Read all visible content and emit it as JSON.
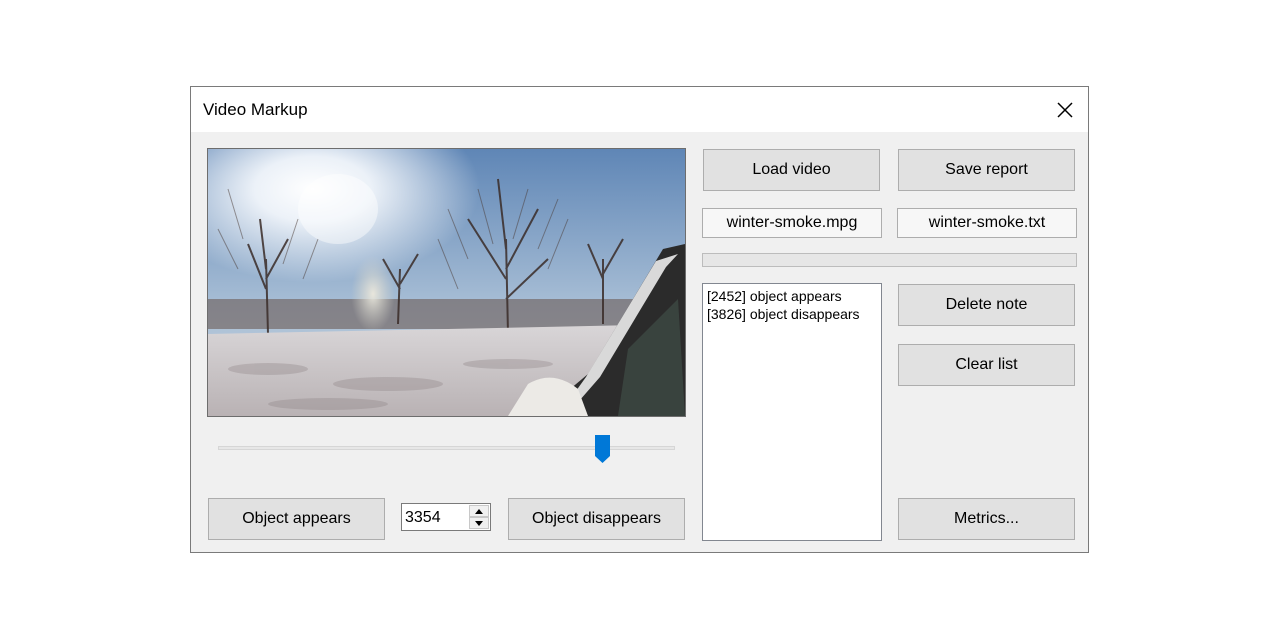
{
  "window": {
    "title": "Video Markup",
    "close_icon": "close-icon"
  },
  "video": {
    "frame_description_icon": "video-preview"
  },
  "slider": {
    "position": 0.84
  },
  "controls": {
    "appears_label": "Object appears",
    "frame_value": "3354",
    "disappears_label": "Object disappears"
  },
  "right": {
    "load_video_label": "Load video",
    "save_report_label": "Save report",
    "video_file": "winter-smoke.mpg",
    "report_file": "winter-smoke.txt",
    "progress": 0,
    "notes": [
      "[2452] object appears",
      "[3826] object disappears"
    ],
    "delete_note_label": "Delete note",
    "clear_list_label": "Clear list",
    "metrics_label": "Metrics..."
  },
  "colors": {
    "slider_thumb": "#0078d7",
    "button_bg": "#e1e1e1",
    "window_bg": "#f0f0f0"
  }
}
